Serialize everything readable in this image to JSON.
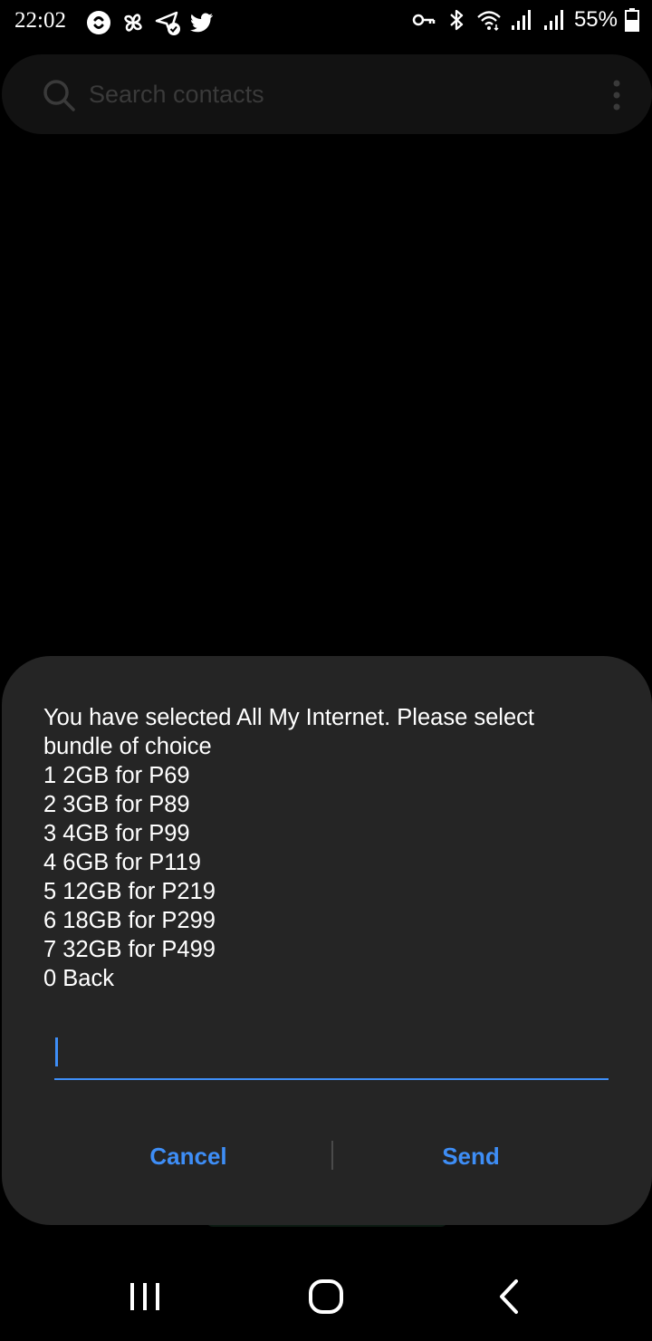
{
  "status_bar": {
    "time": "22:02",
    "left_icons": [
      "shazam-icon",
      "pinwheel-icon",
      "location-check-icon",
      "twitter-icon"
    ],
    "right_icons": [
      "vpn-key-icon",
      "bluetooth-icon",
      "wifi-icon",
      "signal-icon",
      "signal-icon"
    ],
    "battery": "55%"
  },
  "search": {
    "placeholder": "Search contacts"
  },
  "dialog": {
    "message_lines": [
      "You have selected All My Internet. Please select",
      "bundle of choice",
      "1 2GB for P69",
      "2 3GB for P89",
      "3 4GB for P99",
      "4 6GB for P119",
      "5 12GB for P219",
      "6 18GB for P299",
      "7 32GB for P499",
      "0 Back"
    ],
    "input_value": "",
    "cancel_label": "Cancel",
    "send_label": "Send"
  },
  "colors": {
    "accent": "#3e8ef7",
    "dialog_bg": "#252525",
    "background": "#000000"
  }
}
